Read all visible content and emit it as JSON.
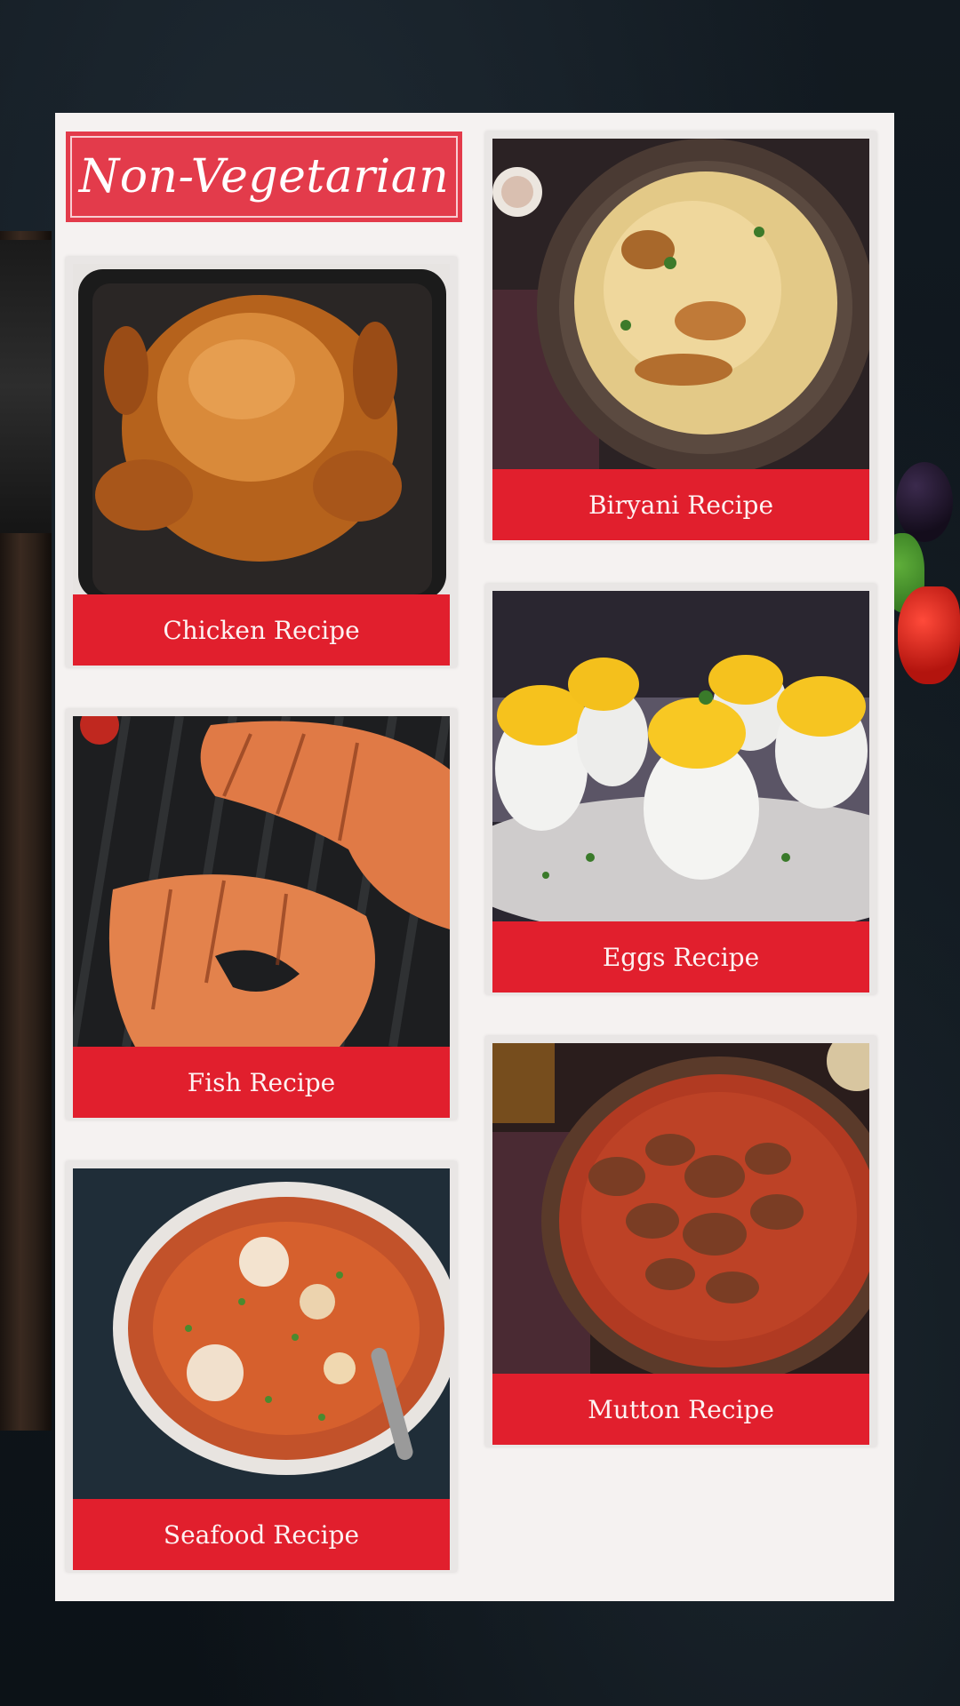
{
  "page": {
    "title": "Non-Vegetarian"
  },
  "cards": [
    {
      "label": "Chicken Recipe",
      "image": "roast-chicken-photo"
    },
    {
      "label": "Biryani Recipe",
      "image": "biryani-photo"
    },
    {
      "label": "Fish Recipe",
      "image": "grilled-salmon-photo"
    },
    {
      "label": "Eggs Recipe",
      "image": "deviled-eggs-photo"
    },
    {
      "label": "Seafood Recipe",
      "image": "seafood-stew-photo"
    },
    {
      "label": "Mutton Recipe",
      "image": "mutton-curry-photo"
    }
  ],
  "colors": {
    "accent": "#e11f2d",
    "title_bg": "#e33b4b",
    "panel_bg": "#f5f2f1",
    "background": "#121a21"
  }
}
